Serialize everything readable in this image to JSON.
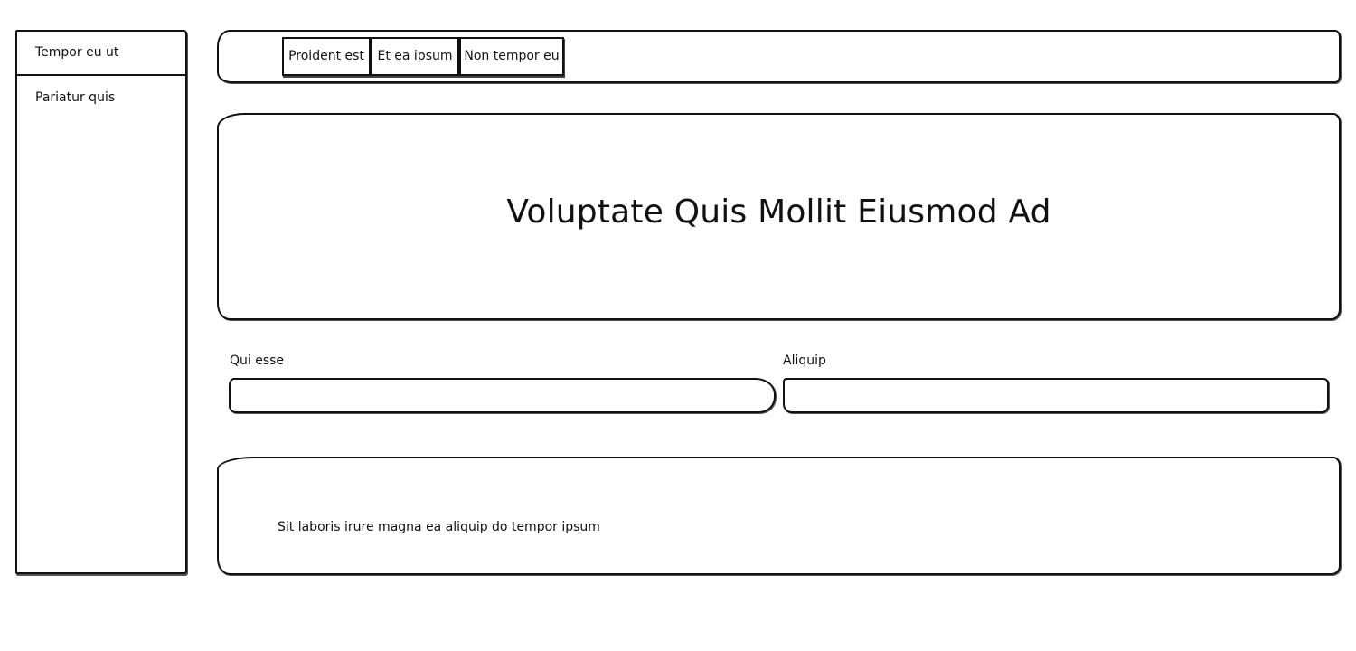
{
  "sidebar": {
    "items": [
      {
        "label": "Tempor eu ut"
      },
      {
        "label": "Pariatur quis"
      }
    ]
  },
  "tabs": [
    {
      "label": "Proident est"
    },
    {
      "label": "Et ea ipsum"
    },
    {
      "label": "Non tempor eu"
    }
  ],
  "hero": {
    "title": "Voluptate Quis Mollit Eiusmod Ad"
  },
  "form": {
    "fields": [
      {
        "label": "Qui esse",
        "value": ""
      },
      {
        "label": "Aliquip",
        "value": ""
      }
    ]
  },
  "footer": {
    "text": "Sit laboris irure magna ea aliquip do tempor ipsum"
  }
}
